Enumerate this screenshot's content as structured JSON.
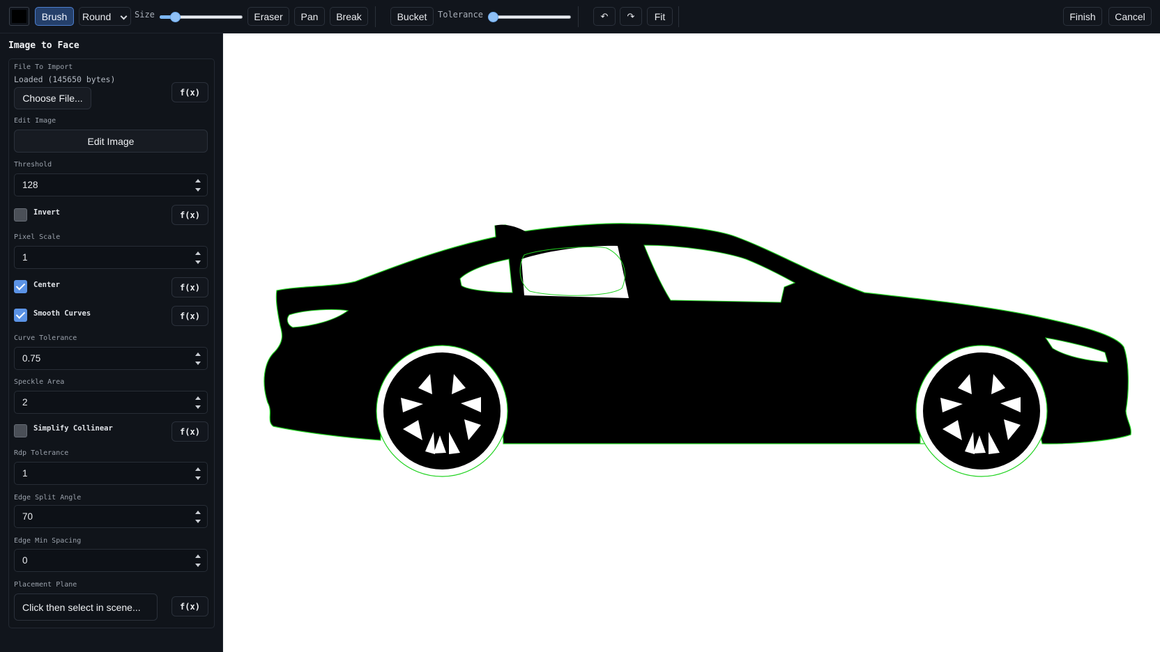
{
  "toolbar": {
    "color_swatch": "#000000",
    "brush_label": "Brush",
    "brush_type_selected": "Round",
    "size_label": "Size",
    "size_value": 0.14,
    "eraser_label": "Eraser",
    "pan_label": "Pan",
    "break_label": "Break",
    "bucket_label": "Bucket",
    "tolerance_label": "Tolerance",
    "tolerance_value": 0.0,
    "undo_icon": "↶",
    "redo_icon": "↷",
    "fit_label": "Fit",
    "finish_label": "Finish",
    "cancel_label": "Cancel"
  },
  "panel": {
    "title": "Image to Face",
    "fx_label": "f(x)",
    "file_to_import": {
      "label": "File To Import",
      "status": "Loaded (145650 bytes)",
      "button": "Choose File..."
    },
    "edit_image": {
      "label": "Edit Image",
      "button": "Edit Image"
    },
    "threshold": {
      "label": "Threshold",
      "value": "128"
    },
    "invert": {
      "label": "Invert",
      "checked": false
    },
    "pixel_scale": {
      "label": "Pixel Scale",
      "value": "1"
    },
    "center": {
      "label": "Center",
      "checked": true
    },
    "smooth_curves": {
      "label": "Smooth Curves",
      "checked": true
    },
    "curve_tolerance": {
      "label": "Curve Tolerance",
      "value": "0.75"
    },
    "speckle_area": {
      "label": "Speckle Area",
      "value": "2"
    },
    "simplify_collinear": {
      "label": "Simplify Collinear",
      "checked": false
    },
    "rdp_tolerance": {
      "label": "Rdp Tolerance",
      "value": "1"
    },
    "edge_split_angle": {
      "label": "Edge Split Angle",
      "value": "70"
    },
    "edge_min_spacing": {
      "label": "Edge Min Spacing",
      "value": "0"
    },
    "placement_plane": {
      "label": "Placement Plane",
      "button": "Click then select in scene..."
    }
  },
  "colors": {
    "accent": "#5b93e6",
    "outline": "#22d322",
    "silhouette": "#000000",
    "canvas": "#ffffff"
  }
}
